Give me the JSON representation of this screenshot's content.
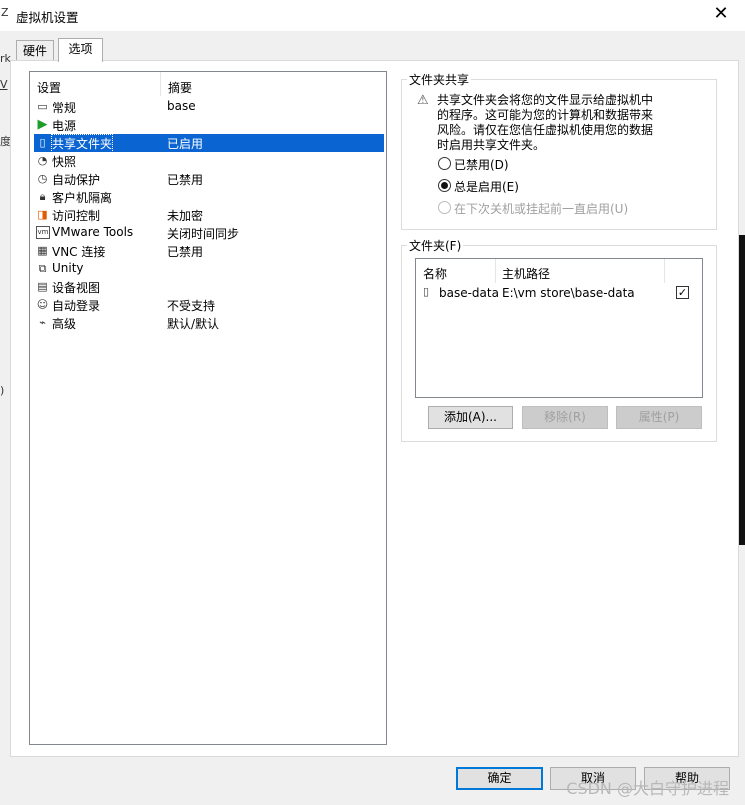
{
  "window": {
    "title": "虚拟机设置",
    "close_glyph": "✕"
  },
  "background_bleed": {
    "left_top": "Z",
    "left_mid1": "rk",
    "left_mid2": "V",
    "left_mid3": "度",
    "left_bottom": ")"
  },
  "tabs": [
    {
      "label": "硬件"
    },
    {
      "label": "选项"
    }
  ],
  "settings_list": {
    "headers": {
      "setting": "设置",
      "summary": "摘要"
    },
    "items": [
      {
        "label": "常规",
        "summary": "base",
        "icon": "general-icon"
      },
      {
        "label": "电源",
        "summary": "",
        "icon": "power-icon"
      },
      {
        "label": "共享文件夹",
        "summary": "已启用",
        "icon": "shared-folder-icon"
      },
      {
        "label": "快照",
        "summary": "",
        "icon": "snapshot-icon"
      },
      {
        "label": "自动保护",
        "summary": "已禁用",
        "icon": "autoprotect-icon"
      },
      {
        "label": "客户机隔离",
        "summary": "",
        "icon": "isolation-icon"
      },
      {
        "label": "访问控制",
        "summary": "未加密",
        "icon": "access-control-icon"
      },
      {
        "label": "VMware Tools",
        "summary": "关闭时间同步",
        "icon": "vmware-tools-icon"
      },
      {
        "label": "VNC 连接",
        "summary": "已禁用",
        "icon": "vnc-icon"
      },
      {
        "label": "Unity",
        "summary": "",
        "icon": "unity-icon"
      },
      {
        "label": "设备视图",
        "summary": "",
        "icon": "device-view-icon"
      },
      {
        "label": "自动登录",
        "summary": "不受支持",
        "icon": "autologin-icon"
      },
      {
        "label": "高级",
        "summary": "默认/默认",
        "icon": "advanced-icon"
      }
    ],
    "selected_index": 2
  },
  "shared_folders": {
    "legend": "文件夹共享",
    "warning_text": "共享文件夹会将您的文件显示给虚拟机中的程序。这可能为您的计算机和数据带来风险。请仅在您信任虚拟机使用您的数据时启用共享文件夹。",
    "options": [
      {
        "label": "已禁用(D)",
        "selected": false,
        "enabled": true
      },
      {
        "label": "总是启用(E)",
        "selected": true,
        "enabled": true
      },
      {
        "label": "在下次关机或挂起前一直启用(U)",
        "selected": false,
        "enabled": false
      }
    ]
  },
  "folders": {
    "legend": "文件夹(F)",
    "headers": {
      "name": "名称",
      "host_path": "主机路径"
    },
    "rows": [
      {
        "name": "base-data",
        "host_path": "E:\\vm store\\base-data",
        "enabled": true
      }
    ],
    "buttons": {
      "add": "添加(A)...",
      "remove": "移除(R)",
      "properties": "属性(P)"
    }
  },
  "footer": {
    "ok": "确定",
    "cancel": "取消",
    "help": "帮助"
  },
  "watermark": "CSDN @大白守护进程",
  "colors": {
    "selection": "#0a64d1",
    "default_button_border": "#0078d7"
  }
}
